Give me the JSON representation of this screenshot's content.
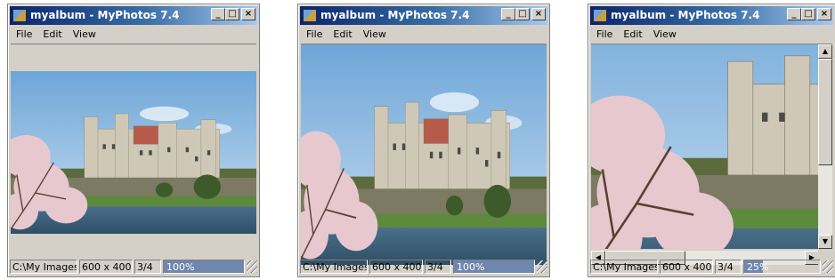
{
  "windows": [
    {
      "title": "myalbum - MyPhotos 7.4",
      "menu": [
        "File",
        "Edit",
        "View"
      ],
      "status": {
        "path": "C:\\My Images\\S",
        "size": "600 x 400",
        "page": "3/4",
        "zoom": "100%"
      },
      "zoom_level": 1.0
    },
    {
      "title": "myalbum - MyPhotos 7.4",
      "menu": [
        "File",
        "Edit",
        "View"
      ],
      "status": {
        "path": "C:\\My Images\\S",
        "size": "600 x 400",
        "page": "3/4",
        "zoom": "100%"
      },
      "zoom_level": 1.0
    },
    {
      "title": "myalbum - MyPhotos 7.4",
      "menu": [
        "File",
        "Edit",
        "View"
      ],
      "status": {
        "path": "C:\\My Images\\S",
        "size": "600 x 400",
        "page": "3/4",
        "zoom": "25%"
      },
      "zoom_level": 0.25
    }
  ],
  "caption_buttons": [
    "_",
    "□",
    "×"
  ],
  "icons": {
    "app": "app-icon",
    "minimize": "minimize-icon",
    "maximize": "maximize-icon",
    "close": "close-icon"
  },
  "colors": {
    "titlebar_start": "#0a246a",
    "titlebar_end": "#a6caf0",
    "status_fill": "#6f86ad"
  }
}
